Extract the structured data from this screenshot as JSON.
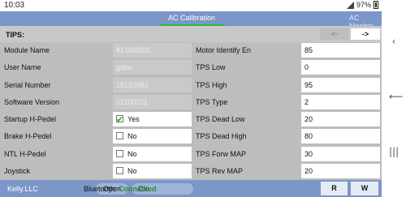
{
  "status": {
    "time": "10:03",
    "battery": "97%"
  },
  "tabs": [
    {
      "label": "AC Calibration",
      "active": true
    },
    {
      "label": "AC Monitor",
      "active": false
    }
  ],
  "tips": {
    "label": "TIPS:",
    "prev": "<-",
    "next": "->"
  },
  "left_fields": [
    {
      "label": "Module Name",
      "value": "KLS6030S",
      "editable": false
    },
    {
      "label": "User Name",
      "value": "gsbe",
      "editable": false
    },
    {
      "label": "Serial Number",
      "value": "18183981",
      "editable": false
    },
    {
      "label": "Software Version",
      "value": "01100011",
      "editable": false
    },
    {
      "label": "Startup H-Pedel",
      "value": "Yes",
      "checked": true
    },
    {
      "label": "Brake H-Pedel",
      "value": "No",
      "checked": false
    },
    {
      "label": "NTL H-Pedel",
      "value": "No",
      "checked": false
    },
    {
      "label": "Joystick",
      "value": "No",
      "checked": false
    }
  ],
  "right_fields": [
    {
      "label": "Motor Identify En",
      "value": "85"
    },
    {
      "label": "TPS Low",
      "value": "0"
    },
    {
      "label": "TPS High",
      "value": "95"
    },
    {
      "label": "TPS Type",
      "value": "2"
    },
    {
      "label": "TPS Dead Low",
      "value": "20"
    },
    {
      "label": "TPS Dead High",
      "value": "80"
    },
    {
      "label": "TPS Forw MAP",
      "value": "30"
    },
    {
      "label": "TPS Rev MAP",
      "value": "20"
    }
  ],
  "bottom": {
    "company": "Kelly.LLC",
    "bluetooth_label": "Bluetooth:",
    "bluetooth_status": "Connected",
    "open_label": "Open",
    "close_label": "Clo",
    "read_label": "R",
    "write_label": "W"
  },
  "nav_rail_icons": [
    "chevron-left-icon",
    "back-icon",
    "recent-apps-icon"
  ],
  "colors": {
    "header_bg": "#7b96c8",
    "tab_active_underline": "#24c13a",
    "grid_bg": "#bdbdbd",
    "connected_text": "#2e8b3a"
  }
}
